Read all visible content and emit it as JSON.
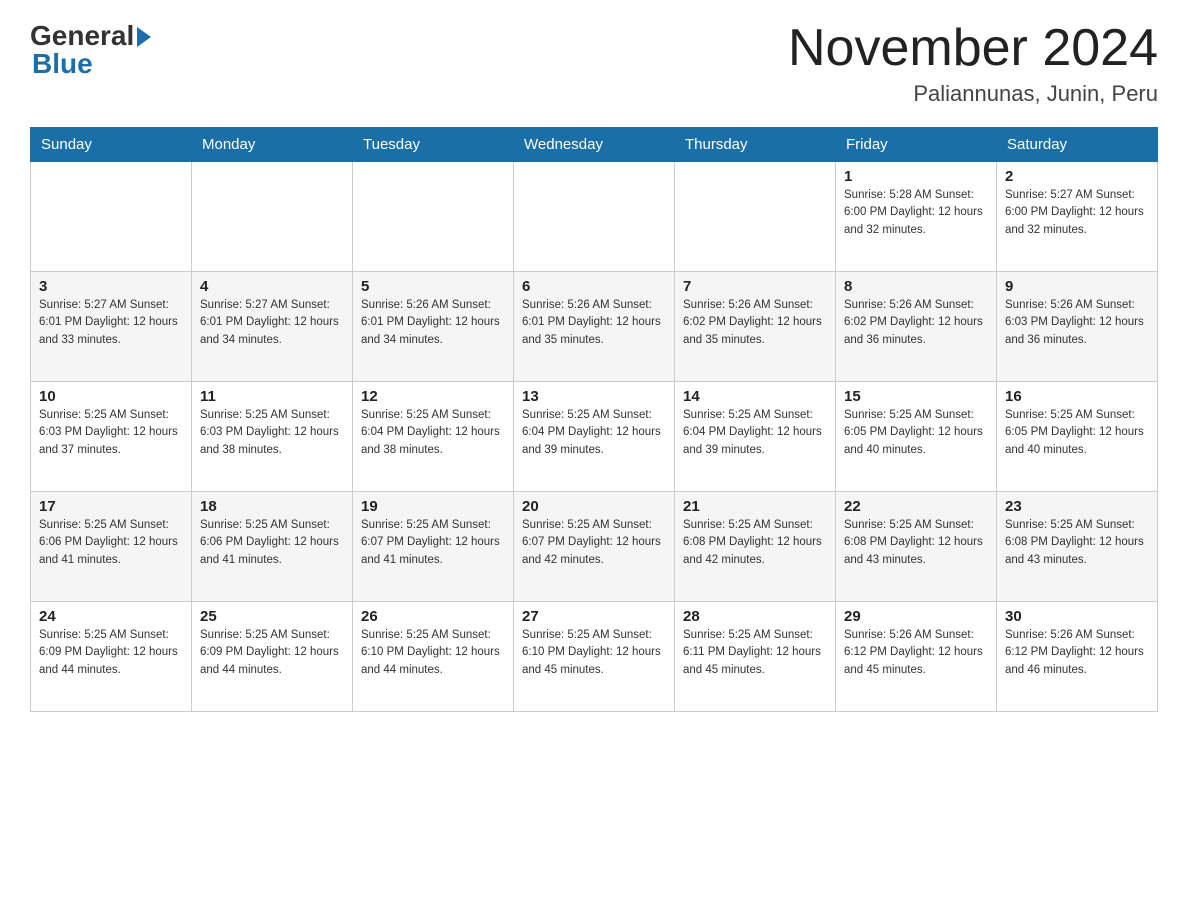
{
  "logo": {
    "general": "General",
    "blue": "Blue"
  },
  "header": {
    "month_year": "November 2024",
    "location": "Paliannunas, Junin, Peru"
  },
  "days_of_week": [
    "Sunday",
    "Monday",
    "Tuesday",
    "Wednesday",
    "Thursday",
    "Friday",
    "Saturday"
  ],
  "weeks": [
    [
      {
        "day": "",
        "info": ""
      },
      {
        "day": "",
        "info": ""
      },
      {
        "day": "",
        "info": ""
      },
      {
        "day": "",
        "info": ""
      },
      {
        "day": "",
        "info": ""
      },
      {
        "day": "1",
        "info": "Sunrise: 5:28 AM\nSunset: 6:00 PM\nDaylight: 12 hours and 32 minutes."
      },
      {
        "day": "2",
        "info": "Sunrise: 5:27 AM\nSunset: 6:00 PM\nDaylight: 12 hours and 32 minutes."
      }
    ],
    [
      {
        "day": "3",
        "info": "Sunrise: 5:27 AM\nSunset: 6:01 PM\nDaylight: 12 hours and 33 minutes."
      },
      {
        "day": "4",
        "info": "Sunrise: 5:27 AM\nSunset: 6:01 PM\nDaylight: 12 hours and 34 minutes."
      },
      {
        "day": "5",
        "info": "Sunrise: 5:26 AM\nSunset: 6:01 PM\nDaylight: 12 hours and 34 minutes."
      },
      {
        "day": "6",
        "info": "Sunrise: 5:26 AM\nSunset: 6:01 PM\nDaylight: 12 hours and 35 minutes."
      },
      {
        "day": "7",
        "info": "Sunrise: 5:26 AM\nSunset: 6:02 PM\nDaylight: 12 hours and 35 minutes."
      },
      {
        "day": "8",
        "info": "Sunrise: 5:26 AM\nSunset: 6:02 PM\nDaylight: 12 hours and 36 minutes."
      },
      {
        "day": "9",
        "info": "Sunrise: 5:26 AM\nSunset: 6:03 PM\nDaylight: 12 hours and 36 minutes."
      }
    ],
    [
      {
        "day": "10",
        "info": "Sunrise: 5:25 AM\nSunset: 6:03 PM\nDaylight: 12 hours and 37 minutes."
      },
      {
        "day": "11",
        "info": "Sunrise: 5:25 AM\nSunset: 6:03 PM\nDaylight: 12 hours and 38 minutes."
      },
      {
        "day": "12",
        "info": "Sunrise: 5:25 AM\nSunset: 6:04 PM\nDaylight: 12 hours and 38 minutes."
      },
      {
        "day": "13",
        "info": "Sunrise: 5:25 AM\nSunset: 6:04 PM\nDaylight: 12 hours and 39 minutes."
      },
      {
        "day": "14",
        "info": "Sunrise: 5:25 AM\nSunset: 6:04 PM\nDaylight: 12 hours and 39 minutes."
      },
      {
        "day": "15",
        "info": "Sunrise: 5:25 AM\nSunset: 6:05 PM\nDaylight: 12 hours and 40 minutes."
      },
      {
        "day": "16",
        "info": "Sunrise: 5:25 AM\nSunset: 6:05 PM\nDaylight: 12 hours and 40 minutes."
      }
    ],
    [
      {
        "day": "17",
        "info": "Sunrise: 5:25 AM\nSunset: 6:06 PM\nDaylight: 12 hours and 41 minutes."
      },
      {
        "day": "18",
        "info": "Sunrise: 5:25 AM\nSunset: 6:06 PM\nDaylight: 12 hours and 41 minutes."
      },
      {
        "day": "19",
        "info": "Sunrise: 5:25 AM\nSunset: 6:07 PM\nDaylight: 12 hours and 41 minutes."
      },
      {
        "day": "20",
        "info": "Sunrise: 5:25 AM\nSunset: 6:07 PM\nDaylight: 12 hours and 42 minutes."
      },
      {
        "day": "21",
        "info": "Sunrise: 5:25 AM\nSunset: 6:08 PM\nDaylight: 12 hours and 42 minutes."
      },
      {
        "day": "22",
        "info": "Sunrise: 5:25 AM\nSunset: 6:08 PM\nDaylight: 12 hours and 43 minutes."
      },
      {
        "day": "23",
        "info": "Sunrise: 5:25 AM\nSunset: 6:08 PM\nDaylight: 12 hours and 43 minutes."
      }
    ],
    [
      {
        "day": "24",
        "info": "Sunrise: 5:25 AM\nSunset: 6:09 PM\nDaylight: 12 hours and 44 minutes."
      },
      {
        "day": "25",
        "info": "Sunrise: 5:25 AM\nSunset: 6:09 PM\nDaylight: 12 hours and 44 minutes."
      },
      {
        "day": "26",
        "info": "Sunrise: 5:25 AM\nSunset: 6:10 PM\nDaylight: 12 hours and 44 minutes."
      },
      {
        "day": "27",
        "info": "Sunrise: 5:25 AM\nSunset: 6:10 PM\nDaylight: 12 hours and 45 minutes."
      },
      {
        "day": "28",
        "info": "Sunrise: 5:25 AM\nSunset: 6:11 PM\nDaylight: 12 hours and 45 minutes."
      },
      {
        "day": "29",
        "info": "Sunrise: 5:26 AM\nSunset: 6:12 PM\nDaylight: 12 hours and 45 minutes."
      },
      {
        "day": "30",
        "info": "Sunrise: 5:26 AM\nSunset: 6:12 PM\nDaylight: 12 hours and 46 minutes."
      }
    ]
  ]
}
